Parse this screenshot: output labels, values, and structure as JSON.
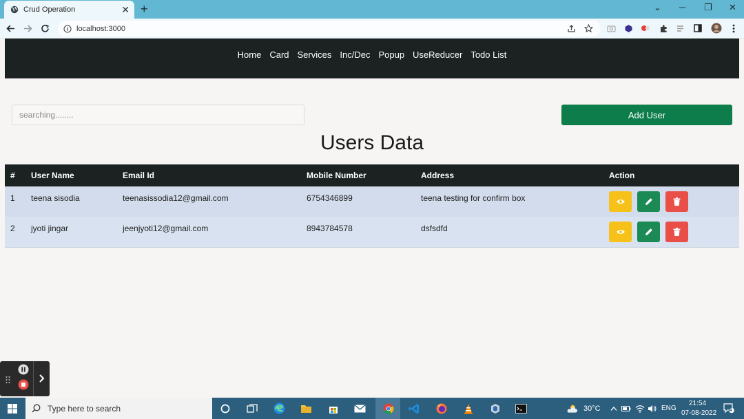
{
  "browser": {
    "tab_title": "Crud Operation",
    "url": "localhost:3000"
  },
  "nav": {
    "items": [
      "Home",
      "Card",
      "Services",
      "Inc/Dec",
      "Popup",
      "UseReducer",
      "Todo List"
    ]
  },
  "search": {
    "placeholder": "searching........"
  },
  "add_button": "Add User",
  "title": "Users Data",
  "table": {
    "headers": [
      "#",
      "User Name",
      "Email Id",
      "Mobile Number",
      "Address",
      "Action"
    ],
    "rows": [
      {
        "id": "1",
        "name": "teena sisodia",
        "email": "teenasissodia12@gmail.com",
        "mobile": "6754346899",
        "address": "teena testing for confirm box"
      },
      {
        "id": "2",
        "name": "jyoti jingar",
        "email": "jeenjyoti12@gmail.com",
        "mobile": "8943784578",
        "address": "dsfsdfd"
      }
    ]
  },
  "taskbar": {
    "search_placeholder": "Type here to search",
    "weather": "30°C",
    "language": "ENG",
    "time": "21:54",
    "date": "07-08-2022",
    "notification_count": "4"
  },
  "colors": {
    "nav_bg": "#1c2222",
    "add_btn": "#0d7d4b",
    "view": "#f6c21a",
    "edit": "#1b8a55",
    "delete": "#e94e48"
  }
}
